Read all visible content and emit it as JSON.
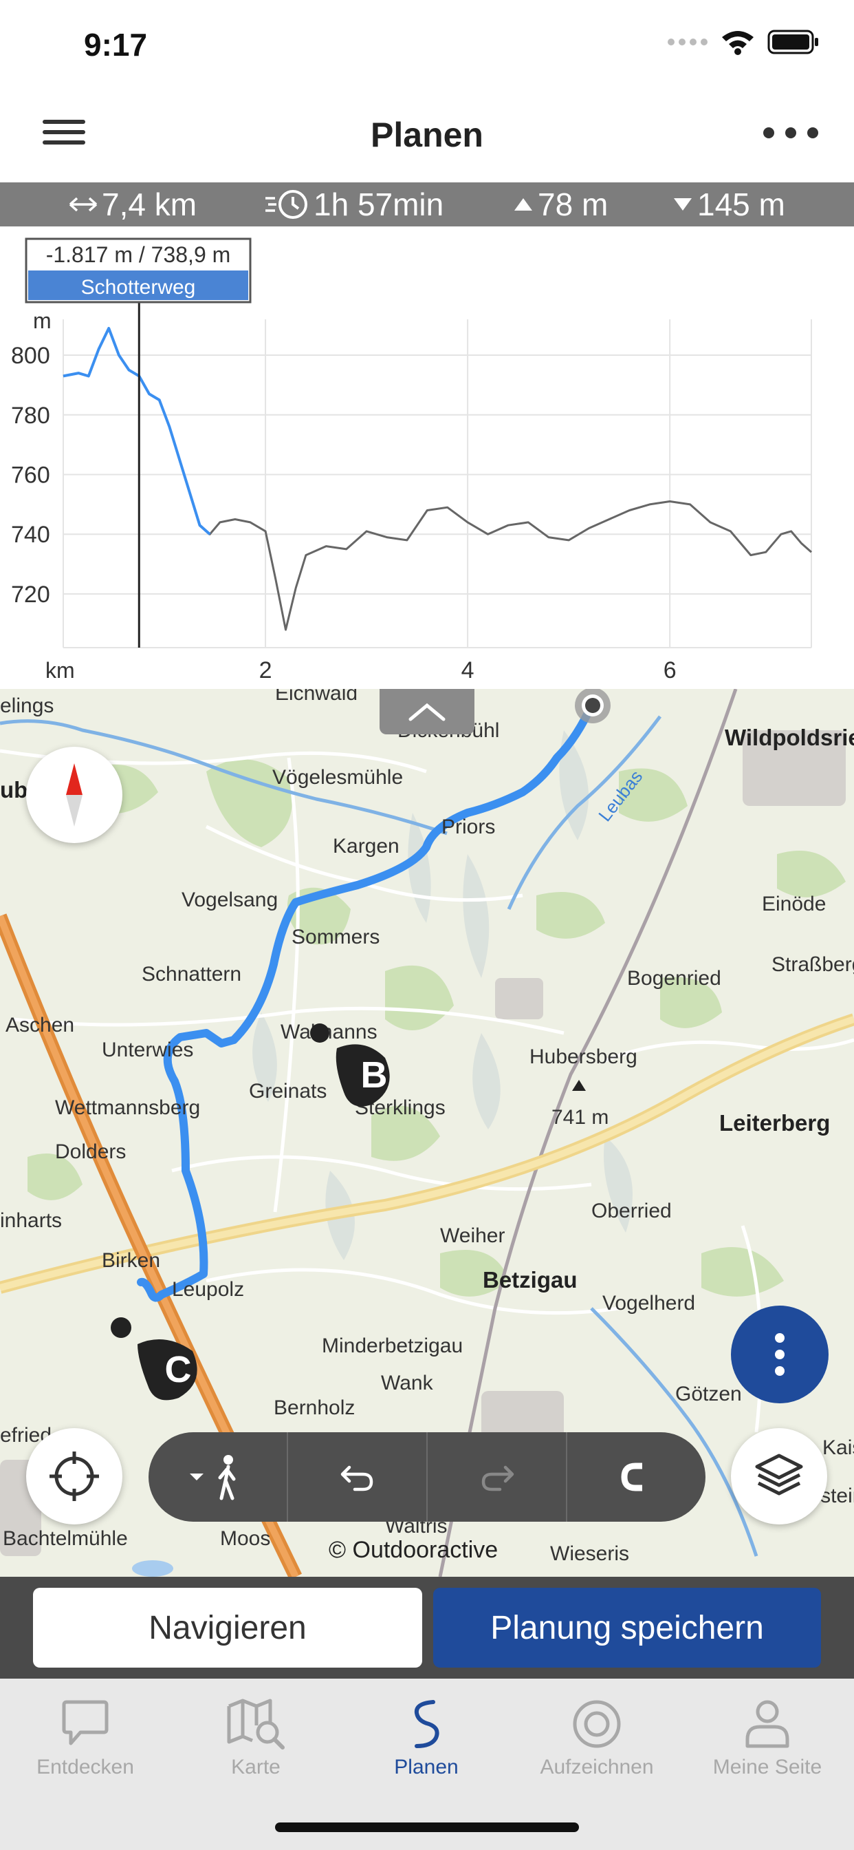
{
  "status": {
    "time": "9:17"
  },
  "header": {
    "title": "Planen"
  },
  "stats": {
    "distance": "7,4 km",
    "duration": "1h 57min",
    "ascent": "78 m",
    "descent": "145 m"
  },
  "chart_data": {
    "type": "line",
    "tooltip": {
      "value": "-1.817 m / 738,9 m",
      "surface": "Schotterweg"
    },
    "xlabel": "km",
    "ylabel": "m",
    "x_ticks": [
      2,
      4,
      6
    ],
    "y_ticks": [
      720,
      740,
      760,
      780,
      800
    ],
    "xlim": [
      0,
      7.4
    ],
    "ylim": [
      702,
      812
    ],
    "cursor_km": 0.75,
    "series": [
      {
        "x": [
          0,
          0.15,
          0.25,
          0.35,
          0.45,
          0.55,
          0.65,
          0.75,
          0.85,
          0.95,
          1.05,
          1.15,
          1.25,
          1.35,
          1.45,
          1.55,
          1.7,
          1.85,
          2.0,
          2.1,
          2.2,
          2.3,
          2.4,
          2.6,
          2.8,
          3.0,
          3.2,
          3.4,
          3.6,
          3.8,
          4.0,
          4.2,
          4.4,
          4.6,
          4.8,
          5.0,
          5.2,
          5.4,
          5.6,
          5.8,
          6.0,
          6.2,
          6.4,
          6.6,
          6.8,
          6.95,
          7.1,
          7.2,
          7.3,
          7.4
        ],
        "values": [
          793,
          794,
          793,
          802,
          809,
          800,
          795,
          793,
          787,
          785,
          776,
          765,
          754,
          743,
          740,
          744,
          745,
          744,
          741,
          725,
          708,
          722,
          733,
          736,
          735,
          741,
          739,
          738,
          748,
          749,
          744,
          740,
          743,
          744,
          739,
          738,
          742,
          745,
          748,
          750,
          751,
          750,
          744,
          741,
          733,
          734,
          740,
          741,
          737,
          734
        ]
      }
    ]
  },
  "map": {
    "labels": [
      {
        "text": "elings"
      },
      {
        "text": "Eichwald"
      },
      {
        "text": "Dickenbühl"
      },
      {
        "text": "Wildpoldsried"
      },
      {
        "text": "uba"
      },
      {
        "text": "Vögelesmühle"
      },
      {
        "text": "Priors"
      },
      {
        "text": "Leubas"
      },
      {
        "text": "Kargen"
      },
      {
        "text": "Vogelsang"
      },
      {
        "text": "Einöde"
      },
      {
        "text": "Sommers"
      },
      {
        "text": "Schnattern"
      },
      {
        "text": "Bogenried"
      },
      {
        "text": "Straßberg"
      },
      {
        "text": "Aschen"
      },
      {
        "text": "Walmanns"
      },
      {
        "text": "Unterwies"
      },
      {
        "text": "Hubersberg"
      },
      {
        "text": "Greinats"
      },
      {
        "text": "Wettmannsberg"
      },
      {
        "text": "Sterklings"
      },
      {
        "text": "741 m"
      },
      {
        "text": "Leiterberg"
      },
      {
        "text": "Dolders"
      },
      {
        "text": "inharts"
      },
      {
        "text": "Oberried"
      },
      {
        "text": "Weiher"
      },
      {
        "text": "Birken"
      },
      {
        "text": "Betzigau"
      },
      {
        "text": "Leupolz"
      },
      {
        "text": "Vogelherd"
      },
      {
        "text": "Minderbetzigau"
      },
      {
        "text": "Wank"
      },
      {
        "text": "Götzen"
      },
      {
        "text": "Bernholz"
      },
      {
        "text": "Kaise"
      },
      {
        "text": "efried"
      },
      {
        "text": "Bachtelmühle"
      },
      {
        "text": "Moos"
      },
      {
        "text": "Waltris"
      },
      {
        "text": "Wieseris"
      },
      {
        "text": "Baltenstein"
      }
    ],
    "marker_b": "B",
    "marker_c": "C",
    "copyright": "© Outdooractive"
  },
  "actions": {
    "navigate": "Navigieren",
    "save": "Planung speichern"
  },
  "tabs": [
    {
      "label": "Entdecken",
      "icon": "chat-bubble-icon"
    },
    {
      "label": "Karte",
      "icon": "map-search-icon"
    },
    {
      "label": "Planen",
      "icon": "route-icon"
    },
    {
      "label": "Aufzeichnen",
      "icon": "record-icon"
    },
    {
      "label": "Meine Seite",
      "icon": "user-icon"
    }
  ],
  "colors": {
    "accent": "#1f4b9b",
    "route": "#3b8ff0",
    "stats_bg": "#7d7d7d"
  }
}
